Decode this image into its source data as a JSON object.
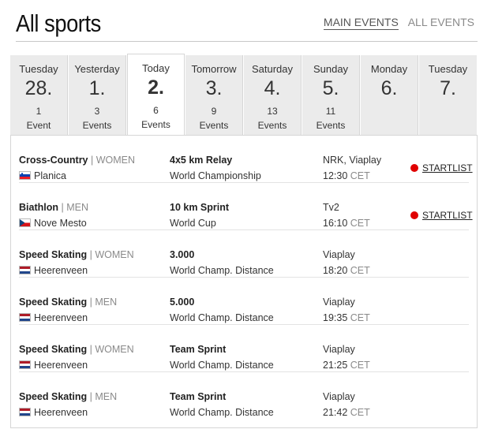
{
  "header": {
    "title": "All sports",
    "main_events": "MAIN EVENTS",
    "all_events": "ALL EVENTS"
  },
  "days": [
    {
      "name": "Tuesday",
      "num": "28.",
      "count": "1",
      "label": "Event"
    },
    {
      "name": "Yesterday",
      "num": "1.",
      "count": "3",
      "label": "Events"
    },
    {
      "name": "Today",
      "num": "2.",
      "count": "6",
      "label": "Events"
    },
    {
      "name": "Tomorrow",
      "num": "3.",
      "count": "9",
      "label": "Events"
    },
    {
      "name": "Saturday",
      "num": "4.",
      "count": "13",
      "label": "Events"
    },
    {
      "name": "Sunday",
      "num": "5.",
      "count": "11",
      "label": "Events"
    },
    {
      "name": "Monday",
      "num": "6.",
      "count": "",
      "label": ""
    },
    {
      "name": "Tuesday",
      "num": "7.",
      "count": "",
      "label": ""
    }
  ],
  "events": [
    {
      "sport": "Cross-Country",
      "gender": "| WOMEN",
      "venue": "Planica",
      "flag": "slovenia",
      "event": "4x5 km Relay",
      "competition": "World Championship",
      "tv": "NRK, Viaplay",
      "time": "12:30",
      "tz": "CET",
      "startlist": "STARTLIST"
    },
    {
      "sport": "Biathlon",
      "gender": "| MEN",
      "venue": "Nove Mesto",
      "flag": "czech",
      "event": "10 km Sprint",
      "competition": "World Cup",
      "tv": "Tv2",
      "time": "16:10",
      "tz": "CET",
      "startlist": "STARTLIST"
    },
    {
      "sport": "Speed Skating",
      "gender": "| WOMEN",
      "venue": "Heerenveen",
      "flag": "netherlands",
      "event": "3.000",
      "competition": "World Champ. Distance",
      "tv": "Viaplay",
      "time": "18:20",
      "tz": "CET",
      "startlist": ""
    },
    {
      "sport": "Speed Skating",
      "gender": "| MEN",
      "venue": "Heerenveen",
      "flag": "netherlands",
      "event": "5.000",
      "competition": "World Champ. Distance",
      "tv": "Viaplay",
      "time": "19:35",
      "tz": "CET",
      "startlist": ""
    },
    {
      "sport": "Speed Skating",
      "gender": "| WOMEN",
      "venue": "Heerenveen",
      "flag": "netherlands",
      "event": "Team Sprint",
      "competition": "World Champ. Distance",
      "tv": "Viaplay",
      "time": "21:25",
      "tz": "CET",
      "startlist": ""
    },
    {
      "sport": "Speed Skating",
      "gender": "| MEN",
      "venue": "Heerenveen",
      "flag": "netherlands",
      "event": "Team Sprint",
      "competition": "World Champ. Distance",
      "tv": "Viaplay",
      "time": "21:42",
      "tz": "CET",
      "startlist": ""
    }
  ],
  "colors": {
    "live_dot": "#e00000",
    "tab_bg": "#ebebeb",
    "muted": "#8a8a8a"
  }
}
